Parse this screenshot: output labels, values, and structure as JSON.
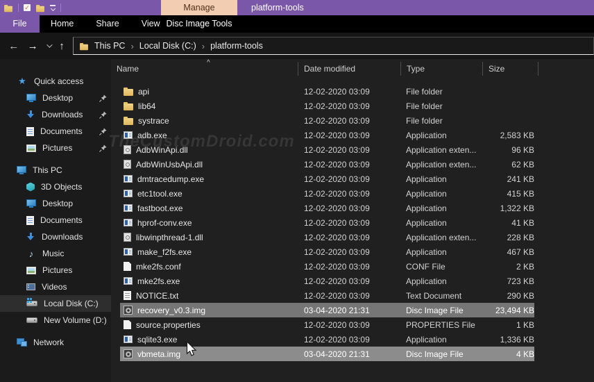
{
  "colors": {
    "titlebar": "#7a57a9",
    "manage_tab_bg": "#f2cdb2",
    "selection_dark": "#767676",
    "selection_light": "#8c8c8c",
    "accent_blue": "#3b8fd8"
  },
  "titlebar": {
    "manage_tab": "Manage",
    "title": "platform-tools",
    "qat_icons": [
      "explorer-folder-icon",
      "checkmark-icon",
      "folder-icon",
      "qat-dropdown-icon"
    ]
  },
  "ribbon": {
    "file_tab": "File",
    "tabs": [
      "Home",
      "Share",
      "View"
    ],
    "contextual_tab": "Disc Image Tools"
  },
  "nav": {
    "breadcrumb": [
      "This PC",
      "Local Disk (C:)",
      "platform-tools"
    ]
  },
  "sidebar": {
    "items": [
      {
        "label": "Quick access",
        "icon": "quick-access-star",
        "level": 0
      },
      {
        "label": "Desktop",
        "icon": "desktop-monitor",
        "level": 1,
        "pinned": true
      },
      {
        "label": "Downloads",
        "icon": "downloads-arrow",
        "level": 1,
        "pinned": true
      },
      {
        "label": "Documents",
        "icon": "document-file",
        "level": 1,
        "pinned": true
      },
      {
        "label": "Pictures",
        "icon": "pictures-image",
        "level": 1,
        "pinned": true
      },
      {
        "spacer": true
      },
      {
        "label": "This PC",
        "icon": "this-pc-monitor",
        "level": 0
      },
      {
        "label": "3D Objects",
        "icon": "cube",
        "level": 1
      },
      {
        "label": "Desktop",
        "icon": "desktop-monitor",
        "level": 1
      },
      {
        "label": "Documents",
        "icon": "document-file",
        "level": 1
      },
      {
        "label": "Downloads",
        "icon": "downloads-arrow",
        "level": 1
      },
      {
        "label": "Music",
        "icon": "music-note",
        "level": 1
      },
      {
        "label": "Pictures",
        "icon": "pictures-image",
        "level": 1
      },
      {
        "label": "Videos",
        "icon": "videos-film",
        "level": 1
      },
      {
        "label": "Local Disk (C:)",
        "icon": "hdd-windows",
        "level": 1,
        "selected": true
      },
      {
        "label": "New Volume (D:)",
        "icon": "hdd",
        "level": 1
      },
      {
        "spacer": true
      },
      {
        "label": "Network",
        "icon": "network-computers",
        "level": 0
      }
    ]
  },
  "file_list": {
    "columns": [
      "Name",
      "Date modified",
      "Type",
      "Size"
    ],
    "sort_indicator": "^",
    "rows": [
      {
        "name": "api",
        "icon": "folder",
        "date": "12-02-2020 03:09",
        "type": "File folder",
        "size": ""
      },
      {
        "name": "lib64",
        "icon": "folder",
        "date": "12-02-2020 03:09",
        "type": "File folder",
        "size": ""
      },
      {
        "name": "systrace",
        "icon": "folder",
        "date": "12-02-2020 03:09",
        "type": "File folder",
        "size": ""
      },
      {
        "name": "adb.exe",
        "icon": "app-window",
        "date": "12-02-2020 03:09",
        "type": "Application",
        "size": "2,583 KB"
      },
      {
        "name": "AdbWinApi.dll",
        "icon": "dll-file",
        "date": "12-02-2020 03:09",
        "type": "Application exten...",
        "size": "96 KB"
      },
      {
        "name": "AdbWinUsbApi.dll",
        "icon": "dll-file",
        "date": "12-02-2020 03:09",
        "type": "Application exten...",
        "size": "62 KB"
      },
      {
        "name": "dmtracedump.exe",
        "icon": "app-window",
        "date": "12-02-2020 03:09",
        "type": "Application",
        "size": "241 KB"
      },
      {
        "name": "etc1tool.exe",
        "icon": "app-window",
        "date": "12-02-2020 03:09",
        "type": "Application",
        "size": "415 KB"
      },
      {
        "name": "fastboot.exe",
        "icon": "app-window",
        "date": "12-02-2020 03:09",
        "type": "Application",
        "size": "1,322 KB"
      },
      {
        "name": "hprof-conv.exe",
        "icon": "app-window",
        "date": "12-02-2020 03:09",
        "type": "Application",
        "size": "41 KB"
      },
      {
        "name": "libwinpthread-1.dll",
        "icon": "dll-file",
        "date": "12-02-2020 03:09",
        "type": "Application exten...",
        "size": "228 KB"
      },
      {
        "name": "make_f2fs.exe",
        "icon": "app-window",
        "date": "12-02-2020 03:09",
        "type": "Application",
        "size": "467 KB"
      },
      {
        "name": "mke2fs.conf",
        "icon": "blank-file",
        "date": "12-02-2020 03:09",
        "type": "CONF File",
        "size": "2 KB"
      },
      {
        "name": "mke2fs.exe",
        "icon": "app-window",
        "date": "12-02-2020 03:09",
        "type": "Application",
        "size": "723 KB"
      },
      {
        "name": "NOTICE.txt",
        "icon": "text-file",
        "date": "12-02-2020 03:09",
        "type": "Text Document",
        "size": "290 KB"
      },
      {
        "name": "recovery_v0.3.img",
        "icon": "disc-image",
        "date": "03-04-2020 21:31",
        "type": "Disc Image File",
        "size": "23,494 KB",
        "selected": "dark"
      },
      {
        "name": "source.properties",
        "icon": "blank-file",
        "date": "12-02-2020 03:09",
        "type": "PROPERTIES File",
        "size": "1 KB"
      },
      {
        "name": "sqlite3.exe",
        "icon": "app-window",
        "date": "12-02-2020 03:09",
        "type": "Application",
        "size": "1,336 KB"
      },
      {
        "name": "vbmeta.img",
        "icon": "disc-image",
        "date": "03-04-2020 21:31",
        "type": "Disc Image File",
        "size": "4 KB",
        "selected": "light"
      }
    ]
  },
  "watermark": "TheCustomDroid.com"
}
